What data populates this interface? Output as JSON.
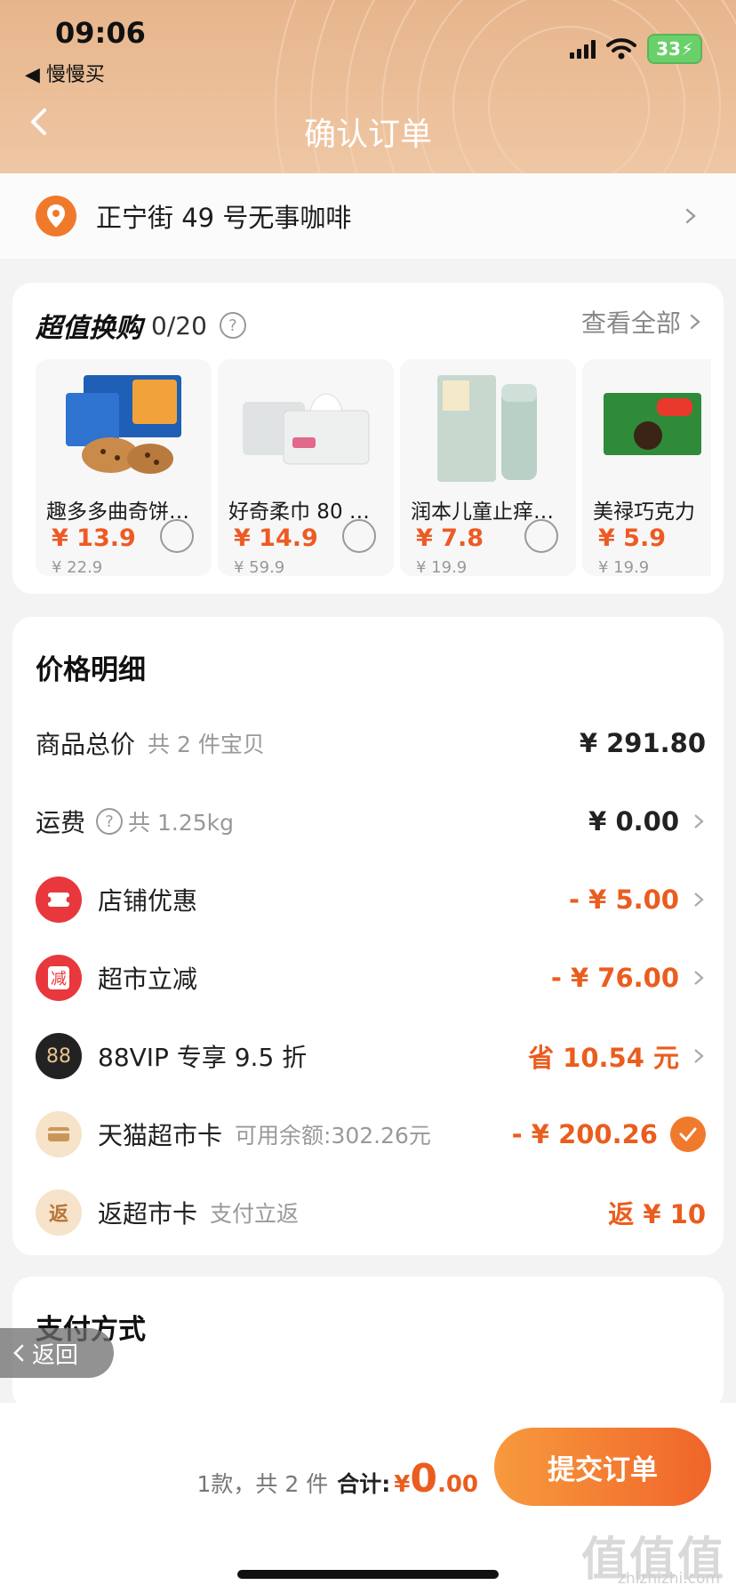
{
  "status_bar": {
    "time": "09:06",
    "back_app": "◀ 慢慢买",
    "battery": "33"
  },
  "nav": {
    "title": "确认订单"
  },
  "address": {
    "text": "正宁街 49 号无事咖啡"
  },
  "exchange": {
    "title": "超值换购",
    "count": "0/20",
    "see_all": "查看全部",
    "products": [
      {
        "name": "趣多多曲奇饼…",
        "price": "¥ 13.9",
        "original": "¥ 22.9"
      },
      {
        "name": "好奇柔巾 80 …",
        "price": "¥ 14.9",
        "original": "¥ 59.9"
      },
      {
        "name": "润本儿童止痒…",
        "price": "¥ 7.8",
        "original": "¥ 19.9"
      },
      {
        "name": "美禄巧克力",
        "price": "¥ 5.9",
        "original": "¥ 19.9"
      }
    ]
  },
  "price_detail": {
    "title": "价格明细",
    "rows": [
      {
        "label": "商品总价",
        "sub": "共 2 件宝贝",
        "value": "¥ 291.80"
      },
      {
        "label": "运费",
        "sub": "共 1.25kg",
        "value": "¥ 0.00"
      },
      {
        "label": "店铺优惠",
        "sub": "",
        "value": "- ¥ 5.00"
      },
      {
        "label": "超市立减",
        "sub": "",
        "value": "- ¥ 76.00",
        "icon_text": "减"
      },
      {
        "label": "88VIP 专享 9.5 折",
        "sub": "",
        "value": "省 10.54 元",
        "icon_text": "88"
      },
      {
        "label": "天猫超市卡",
        "sub": "可用余额:302.26元",
        "value": "- ¥ 200.26"
      },
      {
        "label": "返超市卡",
        "sub": "支付立返",
        "value": "返 ¥ 10",
        "icon_text": "返"
      }
    ]
  },
  "payment": {
    "title": "支付方式"
  },
  "float_back": {
    "label": "返回"
  },
  "bottom_bar": {
    "count_text": "1款，共 2 件",
    "total_label": "合计:",
    "currency": "¥",
    "total_int": "0",
    "total_dec": ".00",
    "submit_label": "提交订单"
  },
  "watermark": {
    "text": "值值值",
    "sub": "zhizhizhi.com"
  },
  "colors": {
    "accent": "#f07a2c",
    "price_orange": "#ea5d1e",
    "header_bg": "#e7b58c"
  }
}
